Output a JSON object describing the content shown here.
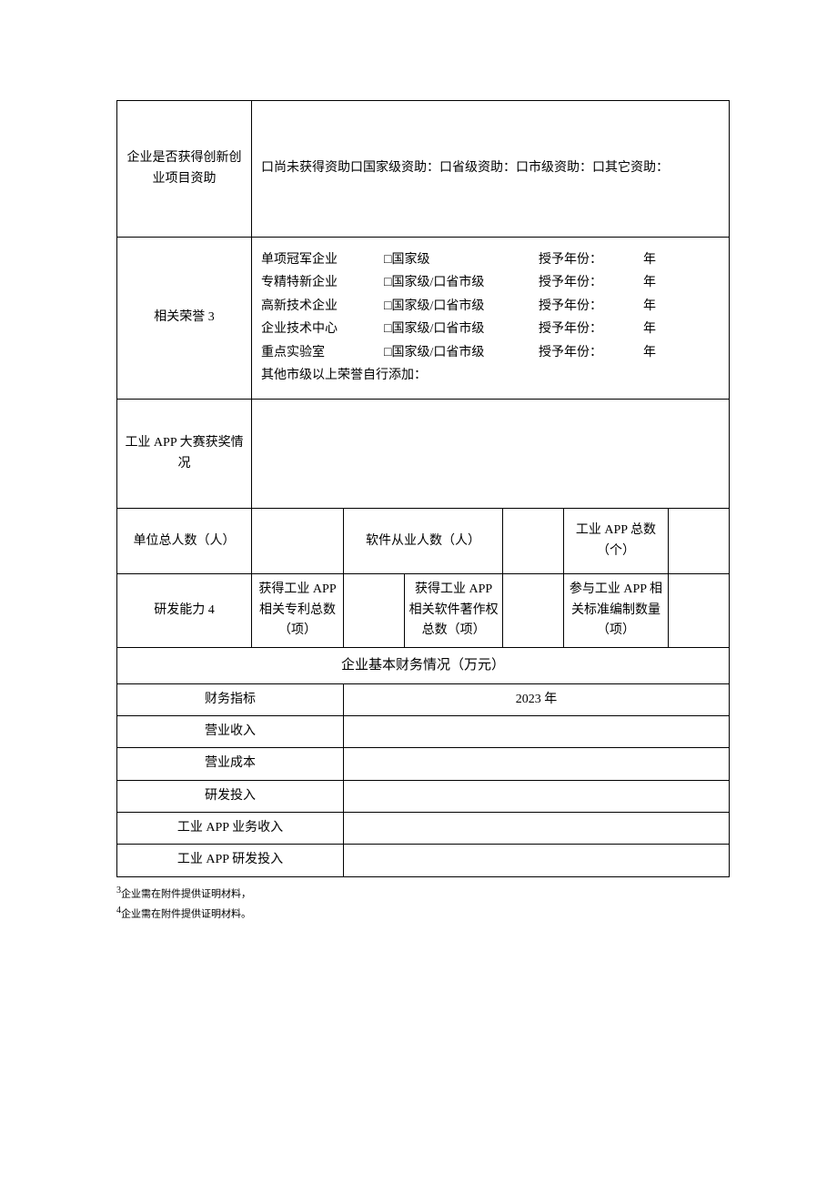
{
  "row1": {
    "label": "企业是否获得创新创业项目资助",
    "content": "口尚未获得资助口国家级资助：口省级资助：口市级资助：口其它资助："
  },
  "row2": {
    "label": "相关荣誉 3",
    "honors": [
      {
        "c1": "单项冠军企业",
        "c2": "□国家级",
        "c3": "授予年份：",
        "c4": "年"
      },
      {
        "c1": "专精特新企业",
        "c2": "□国家级/口省市级",
        "c3": "授予年份：",
        "c4": "年"
      },
      {
        "c1": "高新技术企业",
        "c2": "□国家级/口省市级",
        "c3": "授予年份：",
        "c4": "年"
      },
      {
        "c1": "企业技术中心",
        "c2": "□国家级/口省市级",
        "c3": "授予年份：",
        "c4": "年"
      },
      {
        "c1": "重点实验室",
        "c2": "□国家级/口省市级",
        "c3": "授予年份：",
        "c4": "年"
      }
    ],
    "extra": "其他市级以上荣誉自行添加："
  },
  "row3": {
    "label": "工业 APP 大赛获奖情况"
  },
  "row4": {
    "c1": "单位总人数（人）",
    "c3": "软件从业人数（人）",
    "c5": "工业 APP 总数（个）"
  },
  "row5": {
    "label": "研发能力 4",
    "c2": "获得工业 APP 相关专利总数（项）",
    "c4": "获得工业 APP 相关软件著作权总数（项）",
    "c6": "参与工业 APP 相关标准编制数量（项）"
  },
  "finance_header": "企业基本财务情况（万元）",
  "finance": {
    "col1": "财务指标",
    "col2": "2023 年",
    "rows": [
      "营业收入",
      "营业成本",
      "研发投入",
      "工业 APP 业务收入",
      "工业 APP 研发投入"
    ]
  },
  "footnote3": "企业需在附件提供证明材料，",
  "footnote4": "企业需在附件提供证明材料。"
}
